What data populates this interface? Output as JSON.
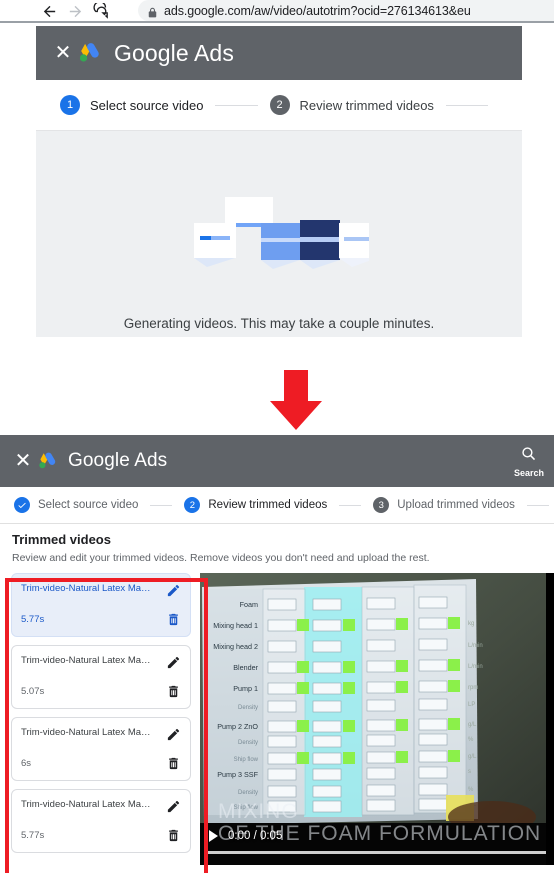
{
  "browser": {
    "back_icon": "arrow-left-icon",
    "forward_icon": "arrow-right-icon",
    "reload_icon": "reload-icon",
    "lock_icon": "lock-icon",
    "url": "ads.google.com/aw/video/autotrim?ocid=276134613&eu"
  },
  "screenshot_top": {
    "header": {
      "close_label": "✕",
      "logo_name": "google-ads-logo",
      "title": "Google Ads"
    },
    "stepper": [
      {
        "number": "1",
        "label": "Select source video",
        "state": "active"
      },
      {
        "number": "2",
        "label": "Review trimmed videos",
        "state": "inactive"
      }
    ],
    "generating": {
      "caption": "Generating videos. This may take a couple minutes."
    }
  },
  "arrow": {
    "name": "down-arrow-annotation",
    "color": "#ee1c24"
  },
  "screenshot_bottom": {
    "header": {
      "close_label": "✕",
      "logo_name": "google-ads-logo",
      "title": "Google Ads",
      "search_label": "Search",
      "search_icon": "search-icon"
    },
    "stepper": [
      {
        "number": "✓",
        "label": "Select source video",
        "state": "done"
      },
      {
        "number": "2",
        "label": "Review trimmed videos",
        "state": "active"
      },
      {
        "number": "3",
        "label": "Upload trimmed videos",
        "state": "inactive"
      }
    ],
    "section": {
      "title": "Trimmed videos",
      "subtitle": "Review and edit your trimmed videos. Remove videos you don't need and upload the rest."
    },
    "videos": [
      {
        "name": "Trim-video-Natural Latex Mattre...",
        "duration": "5.77s",
        "selected": true,
        "edit_icon": "pencil-icon",
        "delete_icon": "trash-icon"
      },
      {
        "name": "Trim-video-Natural Latex Mattre...",
        "duration": "5.07s",
        "selected": false,
        "edit_icon": "pencil-icon",
        "delete_icon": "trash-icon"
      },
      {
        "name": "Trim-video-Natural Latex Mattre...",
        "duration": "6s",
        "selected": false,
        "edit_icon": "pencil-icon",
        "delete_icon": "trash-icon"
      },
      {
        "name": "Trim-video-Natural Latex Mattre...",
        "duration": "5.77s",
        "selected": false,
        "edit_icon": "pencil-icon",
        "delete_icon": "trash-icon"
      }
    ],
    "player": {
      "play_icon": "play-icon",
      "time": "0:00 / 0:05",
      "overlay_line1": "MIXING",
      "overlay_line2": "OF THE FOAM FORMULATION",
      "row_labels": [
        "Foam",
        "Mixing head 1",
        "Mixing head 2",
        "Blender",
        "Pump 1",
        "Density",
        "Pump 2 ZnO",
        "Density",
        "Ship flow",
        "Pump 3 SSF",
        "Density",
        "Ship flow"
      ]
    }
  },
  "colors": {
    "header_gray": "#5f6368",
    "google_blue": "#1a73e8",
    "annotation_red": "#ee1c24",
    "selected_row": "#e8eef9"
  }
}
